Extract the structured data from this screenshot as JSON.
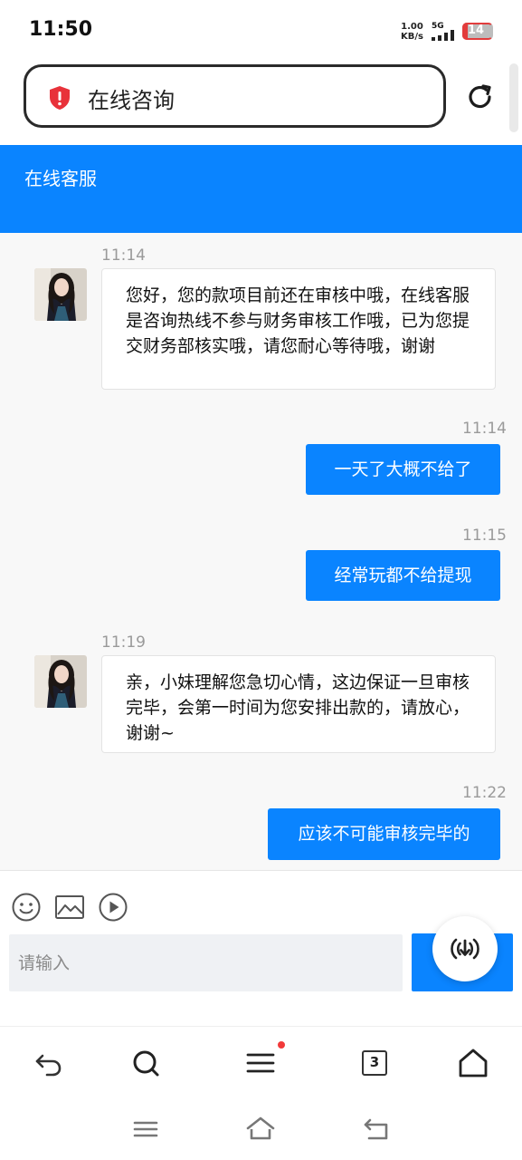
{
  "status_bar": {
    "time": "11:50",
    "speed_value": "1.00",
    "speed_unit": "KB/s",
    "network": "5G",
    "battery": "14"
  },
  "url_bar": {
    "title": "在线咨询"
  },
  "header": {
    "title": "在线客服"
  },
  "messages": [
    {
      "side": "left",
      "time": "11:14",
      "text": "您好，您的款项目前还在审核中哦，在线客服是咨询热线不参与财务审核工作哦，已为您提交财务部核实哦，请您耐心等待哦，谢谢"
    },
    {
      "side": "right",
      "time": "11:14",
      "text": "一天了大概不给了"
    },
    {
      "side": "right",
      "time": "11:15",
      "text": "经常玩都不给提现"
    },
    {
      "side": "left",
      "time": "11:19",
      "text": "亲，小妹理解您急切心情，这边保证一旦审核完毕，会第一时间为您安排出款的，请放心，谢谢~"
    },
    {
      "side": "right",
      "time": "11:22",
      "text": "应该不可能审核完毕的"
    }
  ],
  "input": {
    "placeholder": "请输入"
  },
  "browser_bar": {
    "tab_count": "3"
  },
  "colors": {
    "accent": "#0a84ff",
    "notification_dot": "#f23a3a",
    "shield": "#e8323a"
  }
}
